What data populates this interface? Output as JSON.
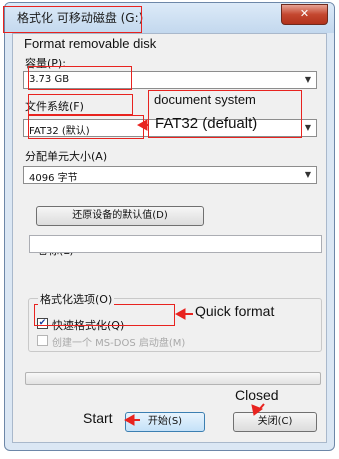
{
  "dialog": {
    "title": "格式化 可移动磁盘 (G:)",
    "close_glyph": "✕"
  },
  "capacity": {
    "label": "容量(P):",
    "value": "3.73 GB"
  },
  "filesystem": {
    "label": "文件系统(F)",
    "value": "FAT32 (默认)"
  },
  "allocation": {
    "label": "分配单元大小(A)",
    "value": "4096 字节"
  },
  "restore_button": {
    "label": "还原设备的默认值(D)"
  },
  "volume_label": {
    "label": "卷标(L)",
    "value": ""
  },
  "format_options": {
    "label": "格式化选项(O)",
    "quick_format": {
      "label": "快速格式化(Q)",
      "checked": true
    },
    "msdos_disk": {
      "label": "创建一个 MS-DOS 启动盘(M)",
      "checked": false,
      "enabled": false
    }
  },
  "progress": {
    "value": 0
  },
  "buttons": {
    "start": "开始(S)",
    "close": "关闭(C)"
  },
  "annotations": {
    "format_removable_disk": "Format removable disk",
    "document_system": "document system",
    "fat32_default": "FAT32 (defualt)",
    "quick_format": "Quick format",
    "closed": "Closed",
    "start": "Start"
  },
  "colors": {
    "annotation_red": "#e8231f",
    "progress_green": "#3cb14a",
    "title_bar": "#c3d8ee",
    "close_button": "#c4472f"
  }
}
